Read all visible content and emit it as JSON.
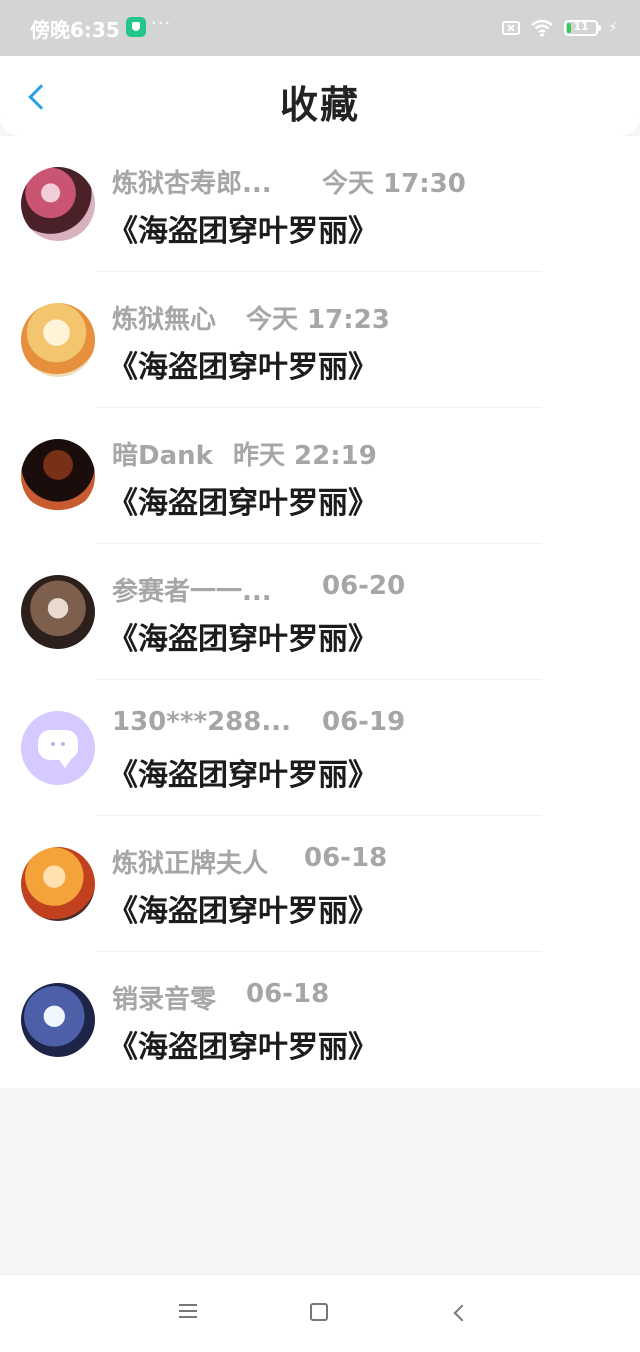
{
  "status_bar": {
    "time": "傍晚6:35",
    "app_icon": "shield-app-icon",
    "dots": "···",
    "sim_icon": "sim-disabled-icon",
    "wifi_icon": "wifi-icon",
    "battery_level": "11",
    "battery_icon": "battery-icon",
    "charge_icon": "charging-icon"
  },
  "header": {
    "title": "收藏",
    "back_icon": "chevron-left-icon"
  },
  "favorites": [
    {
      "name": "炼狱杏寿郎...",
      "time": "今天 17:30",
      "title": "《海盗团穿叶罗丽》"
    },
    {
      "name": "炼狱無心",
      "time": "今天 17:23",
      "title": "《海盗团穿叶罗丽》"
    },
    {
      "name": "暗Dank",
      "time": "昨天 22:19",
      "title": "《海盗团穿叶罗丽》"
    },
    {
      "name": "参赛者一一...",
      "time": "06-20",
      "title": "《海盗团穿叶罗丽》"
    },
    {
      "name": "130***288...",
      "time": "06-19",
      "title": "《海盗团穿叶罗丽》"
    },
    {
      "name": "炼狱正牌夫人",
      "time": "06-18",
      "title": "《海盗团穿叶罗丽》"
    },
    {
      "name": "销录音零",
      "time": "06-18",
      "title": "《海盗团穿叶罗丽》"
    }
  ],
  "nav_bar": {
    "menu_icon": "menu-icon",
    "home_icon": "home-icon",
    "back_icon": "back-icon"
  },
  "colors": {
    "accent": "#27a0e8",
    "meta_text": "#a6a6a6",
    "title_text": "#1c1c1c",
    "status_bar": "#d4d4d4"
  }
}
